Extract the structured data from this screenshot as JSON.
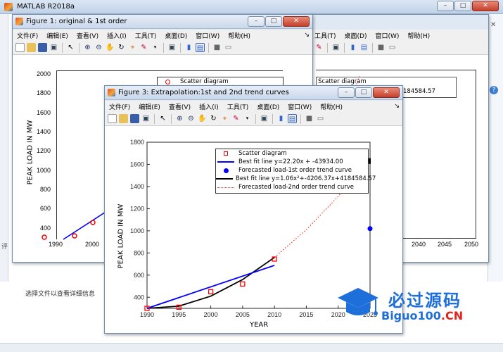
{
  "main_window": {
    "title": "MATLAB R2018a",
    "status_text": "选择文件以查看详细信息",
    "left_edge_labels": [
      "评",
      "↕"
    ]
  },
  "fig1": {
    "title": "Figure 1: original & 1st order",
    "menu": [
      "文件(F)",
      "编辑(E)",
      "查看(V)",
      "插入(I)",
      "工具(T)",
      "桌面(D)",
      "窗口(W)",
      "帮助(H)"
    ],
    "ylabel": "PEAK LOAD IN MW",
    "y_ticks": [
      "2000",
      "1800",
      "1600",
      "1400",
      "1200",
      "1000",
      "800",
      "600",
      "400"
    ],
    "x_ticks": [
      "1990",
      "2000"
    ],
    "legend_first": "Scatter diagram"
  },
  "fig2": {
    "menu": [
      "工具(T)",
      "桌面(D)",
      "窗口(W)",
      "帮助(H)"
    ],
    "legend_first": "Scatter diagram",
    "legend_fragment": "x + 4184584.57",
    "x_ticks": [
      "2040",
      "2045",
      "2050"
    ]
  },
  "fig3": {
    "title": "Figure 3: Extrapolation:1st and 2nd trend curves",
    "menu": [
      "文件(F)",
      "编辑(E)",
      "查看(V)",
      "插入(I)",
      "工具(T)",
      "桌面(D)",
      "窗口(W)",
      "帮助(H)"
    ],
    "ylabel": "PEAK LOAD IN MW",
    "xlabel": "YEAR",
    "y_ticks": [
      "1800",
      "1600",
      "1400",
      "1200",
      "1000",
      "800",
      "600",
      "400"
    ],
    "x_ticks": [
      "1990",
      "1995",
      "2000",
      "2005",
      "2010",
      "2015",
      "2020",
      "2025"
    ],
    "legend": [
      {
        "label": "Scatter diagram"
      },
      {
        "label": "Best fit line y=22.20x + -43934.00"
      },
      {
        "label": "Forecasted load-1st order trend curve"
      },
      {
        "label": "Best fit line y=1.06x²+-4206.37x+4184584.57"
      },
      {
        "label": "Forecasted load-2nd order trend curve"
      }
    ],
    "colors": {
      "scatter": "#ff0000",
      "first_order": "#0000ff",
      "second_order": "#000000",
      "forecast2": "#ff0000"
    }
  },
  "watermark": {
    "cn": "必过源码",
    "en_main": "Biguo100",
    "en_suffix": ".CN"
  },
  "chart_data": {
    "type": "scatter",
    "xlabel": "YEAR",
    "ylabel": "PEAK LOAD IN MW",
    "xlim": [
      1990,
      2025
    ],
    "ylim": [
      400,
      1800
    ],
    "series": [
      {
        "name": "Scatter diagram",
        "x": [
          1990,
          1995,
          2000,
          2005,
          2010
        ],
        "y": [
          300,
          310,
          450,
          520,
          745
        ]
      },
      {
        "name": "Best fit line y=22.20x + -43934.00",
        "x": [
          1990,
          2010
        ],
        "y": [
          244,
          688
        ]
      },
      {
        "name": "Best fit line y=1.06x²+-4206.37x+4184584.57",
        "x": [
          1990,
          1995,
          2000,
          2005,
          2010
        ],
        "y": [
          295,
          320,
          410,
          560,
          760
        ]
      },
      {
        "name": "Forecasted load-2nd order trend curve",
        "x": [
          2010,
          2015,
          2020,
          2025
        ],
        "y": [
          760,
          1010,
          1310,
          1660
        ]
      },
      {
        "name": "Forecasted load-1st order trend curve",
        "x": [
          2025
        ],
        "y": [
          1020
        ]
      }
    ]
  }
}
